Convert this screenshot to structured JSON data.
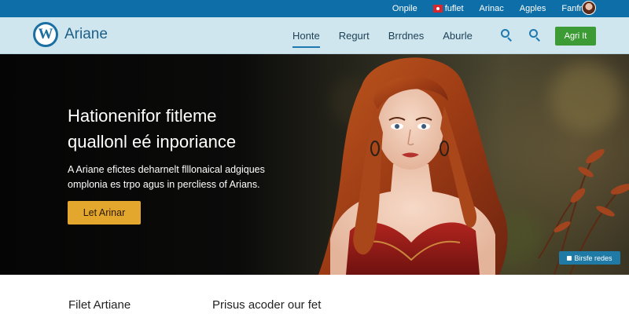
{
  "topbar": {
    "links": [
      "Onpile",
      "fuflet",
      "Arinac",
      "Agples",
      "Fanfris"
    ]
  },
  "header": {
    "logo_letter": "W",
    "brand": "Ariane",
    "nav": [
      "Honte",
      "Regurt",
      "Brrdnes",
      "Aburle"
    ],
    "active_nav": "Honte",
    "cta_label": "Agri It"
  },
  "hero": {
    "title_line1": "Hationenifor fitleme",
    "title_line2": "quallonl eé inporiance",
    "subtitle_line1": "A Ariane efictes deharnelt flllonaical adgiques",
    "subtitle_line2": "omplonia es trpo agus in percliess of Arians.",
    "button_label": "Let Arinar",
    "badge_label": "Birsfe redes"
  },
  "bottom": {
    "col1_title": "Filet Artiane",
    "col2_title": "Prisus acoder our fet"
  },
  "colors": {
    "topbar": "#0e6fa8",
    "header": "#cfe6ef",
    "accent_blue": "#1d79b0",
    "cta_green": "#3d9b35",
    "hero_button": "#e3a72d"
  },
  "icons": [
    "wordpress-logo-icon",
    "search-icon",
    "search-icon",
    "flag-icon",
    "avatar"
  ]
}
